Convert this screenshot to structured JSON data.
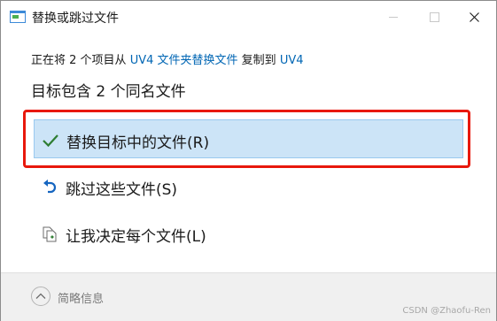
{
  "window": {
    "title": "替换或跳过文件"
  },
  "message": {
    "prefix": "正在将 2 个项目从",
    "source": "UV4",
    "folder_action": "文件夹替换文件",
    "copy_to": "复制到",
    "destination": "UV4"
  },
  "heading": "目标包含 2 个同名文件",
  "options": [
    {
      "label": "替换目标中的文件(R)",
      "icon": "checkmark-icon",
      "selected": true
    },
    {
      "label": "跳过这些文件(S)",
      "icon": "undo-arrow-icon",
      "selected": false
    },
    {
      "label": "让我决定每个文件(L)",
      "icon": "file-compare-icon",
      "selected": false
    }
  ],
  "footer": {
    "toggle_label": "简略信息"
  },
  "watermark": "CSDN @Zhaofu-Ren",
  "colors": {
    "accent": "#0066b4",
    "selected_bg": "#cce4f7",
    "highlight_border": "#e8180c"
  }
}
